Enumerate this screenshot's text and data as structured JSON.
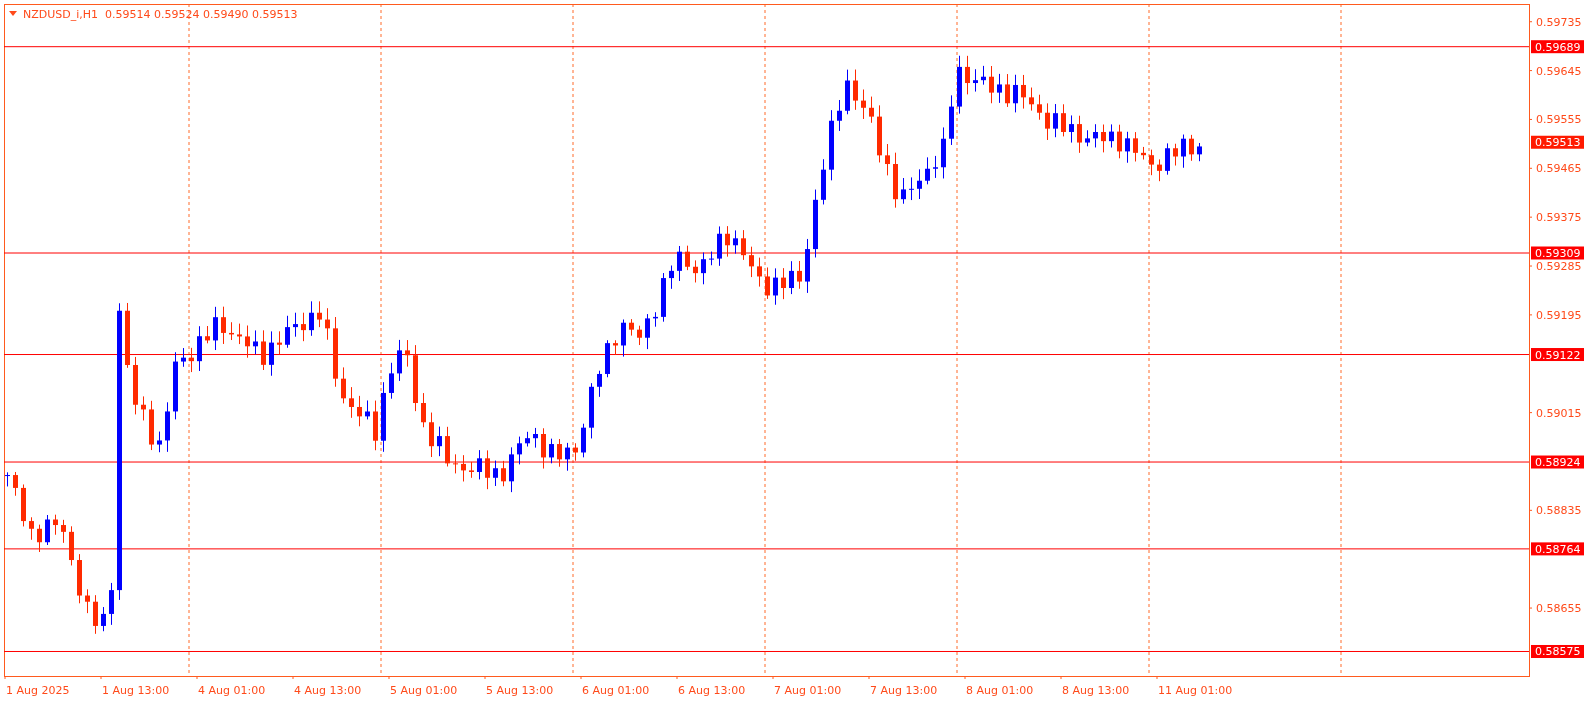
{
  "chart": {
    "title": "NZDUSD_i,H1  0.59514 0.59524 0.59490 0.59513",
    "price_ticks": [
      "0.59735",
      "0.59645",
      "0.59555",
      "0.59465",
      "0.59375",
      "0.59285",
      "0.59195",
      "0.59015",
      "0.58835",
      "0.58655"
    ],
    "levels": [
      {
        "price": "0.59689",
        "kind": "line"
      },
      {
        "price": "0.59513",
        "kind": "bid"
      },
      {
        "price": "0.59309",
        "kind": "line"
      },
      {
        "price": "0.59122",
        "kind": "line"
      },
      {
        "price": "0.58924",
        "kind": "line"
      },
      {
        "price": "0.58764",
        "kind": "line"
      },
      {
        "price": "0.58575",
        "kind": "line"
      }
    ],
    "time_labels": [
      "1 Aug 2025",
      "1 Aug 13:00",
      "4 Aug 01:00",
      "4 Aug 13:00",
      "5 Aug 01:00",
      "5 Aug 13:00",
      "6 Aug 01:00",
      "6 Aug 13:00",
      "7 Aug 01:00",
      "7 Aug 13:00",
      "8 Aug 01:00",
      "8 Aug 13:00",
      "11 Aug 01:00"
    ]
  }
}
